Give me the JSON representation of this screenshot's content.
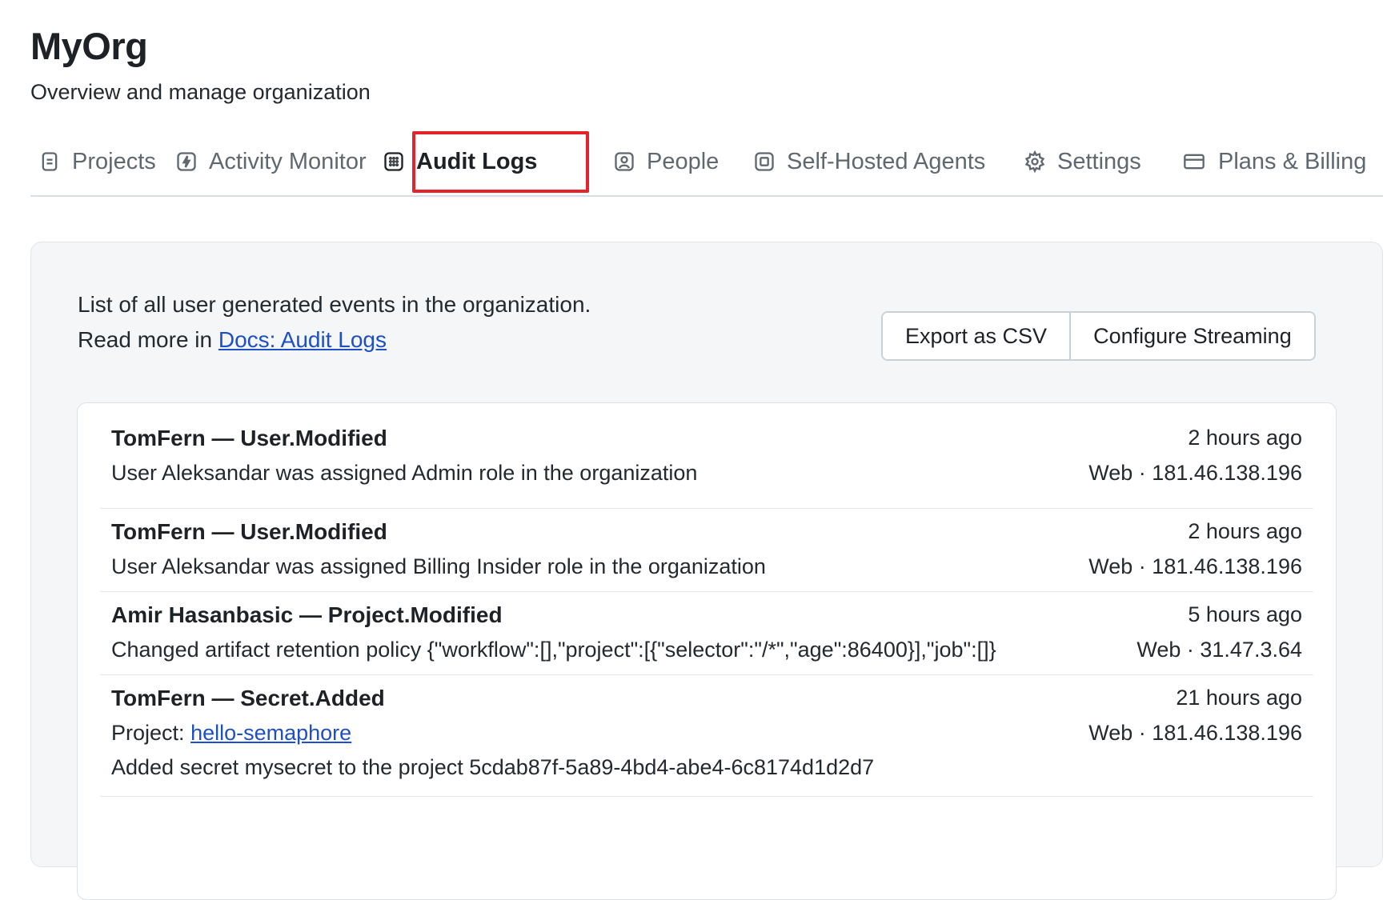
{
  "org": {
    "title": "MyOrg",
    "subtitle": "Overview and manage organization"
  },
  "tabs": [
    {
      "label": "Projects",
      "icon": "document-icon"
    },
    {
      "label": "Activity Monitor",
      "icon": "lightning-icon"
    },
    {
      "label": "Audit Logs",
      "icon": "grid-icon",
      "active": true
    },
    {
      "label": "People",
      "icon": "person-icon"
    },
    {
      "label": "Self-Hosted Agents",
      "icon": "chip-icon"
    },
    {
      "label": "Settings",
      "icon": "gear-icon"
    },
    {
      "label": "Plans & Billing",
      "icon": "credit-card-icon"
    }
  ],
  "audit": {
    "intro": "List of all user generated events in the organization.",
    "read_more": "Read more in",
    "docs_link": "Docs: Audit Logs",
    "export_label": "Export as CSV",
    "configure_label": "Configure Streaming"
  },
  "logs": [
    {
      "title": "TomFern — User.Modified",
      "description": "User Aleksandar was assigned Admin role in the organization",
      "time": "2 hours ago",
      "source": "Web · 181.46.138.196"
    },
    {
      "title": "TomFern — User.Modified",
      "description": "User Aleksandar was assigned Billing Insider role in the organization",
      "time": "2 hours ago",
      "source": "Web · 181.46.138.196"
    },
    {
      "title": "Amir Hasanbasic — Project.Modified",
      "description": "Changed artifact retention policy {\"workflow\":[],\"project\":[{\"selector\":\"/*\",\"age\":86400}],\"job\":[]}",
      "time": "5 hours ago",
      "source": "Web · 31.47.3.64"
    },
    {
      "title": "TomFern — Secret.Added",
      "project_prefix": "Project:",
      "project_link": "hello-semaphore",
      "description2": "Added secret mysecret to the project 5cdab87f-5a89-4bd4-abe4-6c8174d1d2d7",
      "time": "21 hours ago",
      "source": "Web · 181.46.138.196"
    }
  ],
  "colors": {
    "highlight": "#e2252b",
    "link": "#1f4fc4",
    "panel_bg": "#f4f6f8"
  }
}
